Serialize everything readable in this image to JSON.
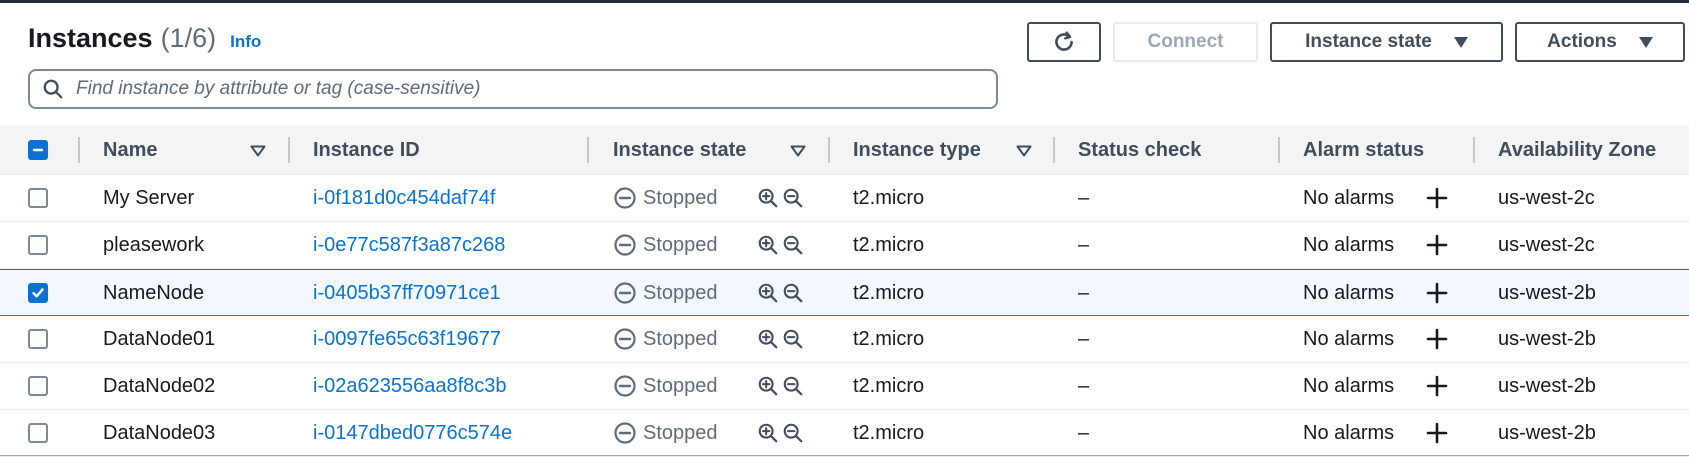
{
  "header": {
    "title": "Instances",
    "count": "(1/6)",
    "info": "Info"
  },
  "search": {
    "placeholder": "Find instance by attribute or tag (case-sensitive)",
    "value": ""
  },
  "toolbar": {
    "refresh_icon": "refresh-icon",
    "connect_label": "Connect",
    "instance_state_label": "Instance state",
    "actions_label": "Actions"
  },
  "columns": [
    {
      "label": "Name"
    },
    {
      "label": "Instance ID"
    },
    {
      "label": "Instance state"
    },
    {
      "label": "Instance type"
    },
    {
      "label": "Status check"
    },
    {
      "label": "Alarm status"
    },
    {
      "label": "Availability Zone"
    }
  ],
  "rows": [
    {
      "name": "My Server",
      "id": "i-0f181d0c454daf74f",
      "state": "Stopped",
      "type": "t2.micro",
      "status": "–",
      "alarm": "No alarms",
      "az": "us-west-2c",
      "selected": false
    },
    {
      "name": "pleasework",
      "id": "i-0e77c587f3a87c268",
      "state": "Stopped",
      "type": "t2.micro",
      "status": "–",
      "alarm": "No alarms",
      "az": "us-west-2c",
      "selected": false
    },
    {
      "name": "NameNode",
      "id": "i-0405b37ff70971ce1",
      "state": "Stopped",
      "type": "t2.micro",
      "status": "–",
      "alarm": "No alarms",
      "az": "us-west-2b",
      "selected": true
    },
    {
      "name": "DataNode01",
      "id": "i-0097fe65c63f19677",
      "state": "Stopped",
      "type": "t2.micro",
      "status": "–",
      "alarm": "No alarms",
      "az": "us-west-2b",
      "selected": false
    },
    {
      "name": "DataNode02",
      "id": "i-02a623556aa8f8c3b",
      "state": "Stopped",
      "type": "t2.micro",
      "status": "–",
      "alarm": "No alarms",
      "az": "us-west-2b",
      "selected": false
    },
    {
      "name": "DataNode03",
      "id": "i-0147dbed0776c574e",
      "state": "Stopped",
      "type": "t2.micro",
      "status": "–",
      "alarm": "No alarms",
      "az": "us-west-2b",
      "selected": false
    }
  ],
  "colors": {
    "link": "#0972d3",
    "text": "#16191f",
    "muted": "#5f6b7a",
    "header_bg": "#f4f4f4"
  }
}
